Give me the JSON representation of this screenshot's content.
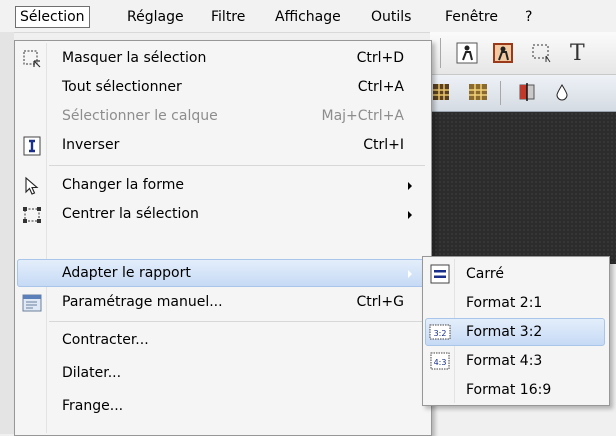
{
  "menubar": {
    "items": [
      {
        "label": "Sélection"
      },
      {
        "label": "Réglage"
      },
      {
        "label": "Filtre"
      },
      {
        "label": "Affichage"
      },
      {
        "label": "Outils"
      },
      {
        "label": "Fenêtre"
      },
      {
        "label": "?"
      }
    ],
    "active_index": 0
  },
  "toolbar": {
    "text_tool_glyph": "T",
    "icons": [
      "person-select-icon",
      "person-cutout-icon",
      "marquee-icon",
      "text-tool-icon",
      "grid-tool-icon",
      "grid-tool-alt-icon",
      "split-view-icon",
      "drop-icon"
    ]
  },
  "selection_menu": {
    "items": [
      {
        "label": "Masquer la sélection",
        "shortcut": "Ctrl+D",
        "icon": "hide-selection-icon",
        "enabled": true
      },
      {
        "label": "Tout sélectionner",
        "shortcut": "Ctrl+A",
        "icon": null,
        "enabled": true
      },
      {
        "label": "Sélectionner le calque",
        "shortcut": "Maj+Ctrl+A",
        "icon": null,
        "enabled": false
      },
      {
        "label": "Inverser",
        "shortcut": "Ctrl+I",
        "icon": "invert-icon",
        "enabled": true
      },
      {
        "label": "Changer la forme",
        "shortcut": "",
        "icon": "cursor-arrow-icon",
        "enabled": true,
        "submenu": true
      },
      {
        "label": "Centrer la sélection",
        "shortcut": "",
        "icon": "center-selection-icon",
        "enabled": true,
        "submenu": true
      },
      {
        "label": "Adapter le rapport",
        "shortcut": "",
        "icon": null,
        "enabled": true,
        "submenu": true,
        "highlighted": true
      },
      {
        "label": "Paramétrage manuel...",
        "shortcut": "Ctrl+G",
        "icon": "manual-settings-icon",
        "enabled": true
      },
      {
        "label": "Contracter...",
        "shortcut": "",
        "icon": null,
        "enabled": true
      },
      {
        "label": "Dilater...",
        "shortcut": "",
        "icon": null,
        "enabled": true
      },
      {
        "label": "Frange...",
        "shortcut": "",
        "icon": null,
        "enabled": true
      }
    ]
  },
  "ratio_submenu": {
    "items": [
      {
        "label": "Carré",
        "icon": "square-ratio-icon",
        "icon_text": ""
      },
      {
        "label": "Format 2:1",
        "icon": null,
        "icon_text": ""
      },
      {
        "label": "Format 3:2",
        "icon": "ratio-3-2-icon",
        "icon_text": "3:2",
        "highlighted": true
      },
      {
        "label": "Format 4:3",
        "icon": "ratio-4-3-icon",
        "icon_text": "4:3"
      },
      {
        "label": "Format 16:9",
        "icon": null,
        "icon_text": ""
      }
    ]
  },
  "colors": {
    "highlight_bg": "#c6daf5",
    "highlight_border": "#a9c5e9",
    "disabled_text": "#8d8d8d",
    "canvas_bg": "#2c2c2c",
    "icon_blue": "#1a2f8a"
  }
}
